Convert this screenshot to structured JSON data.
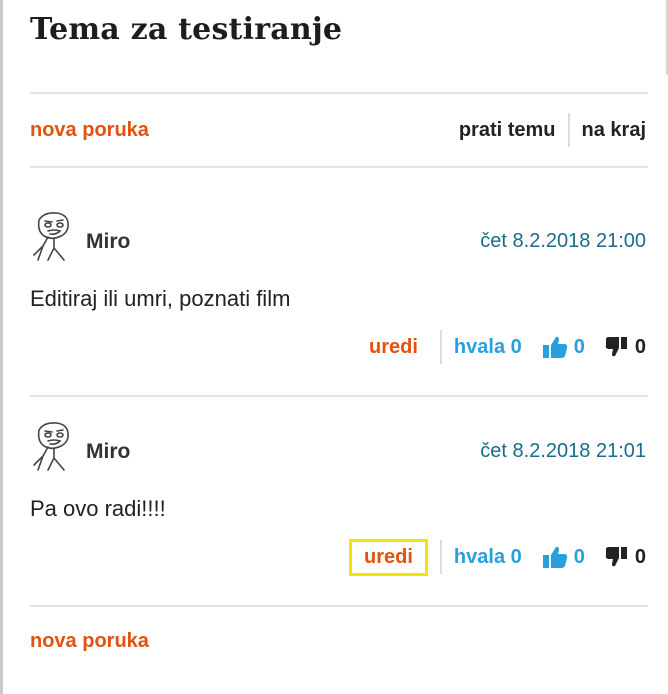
{
  "topic": {
    "title": "Tema za testiranje"
  },
  "toolbar": {
    "new_post": "nova poruka",
    "follow": "prati temu",
    "to_end": "na kraj"
  },
  "posts": [
    {
      "author": "Miro",
      "timestamp": "čet 8.2.2018 21:00",
      "text": "Editiraj ili umri, poznati film",
      "edit_label": "uredi",
      "thanks_label": "hvala 0",
      "likes": "0",
      "dislikes": "0",
      "avatar_icon": "meme-face-avatar-icon"
    },
    {
      "author": "Miro",
      "timestamp": "čet 8.2.2018 21:01",
      "text": "Pa ovo radi!!!!",
      "edit_label": "uredi",
      "thanks_label": "hvala 0",
      "likes": "0",
      "dislikes": "0",
      "avatar_icon": "meme-face-avatar-icon",
      "edit_highlighted": true
    }
  ],
  "footer": {
    "new_post": "nova poruka"
  },
  "colors": {
    "accent_orange": "#e3520e",
    "link_blue": "#2a9fe0",
    "timestamp_blue": "#1a6b8c",
    "highlight": "#f5e300"
  }
}
